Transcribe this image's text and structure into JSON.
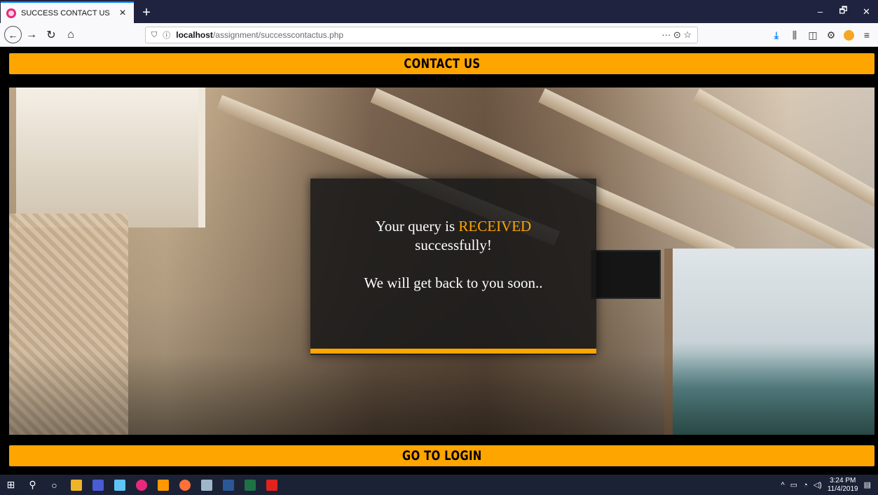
{
  "browser": {
    "tab_title": "SUCCESS CONTACT US",
    "tab_close": "×",
    "new_tab": "+",
    "url_host": "localhost",
    "url_path": "/assignment/successcontactus.php",
    "url_actions": "··· ⊙ ☆",
    "window_controls": [
      "–",
      "🗗",
      "✕"
    ]
  },
  "page": {
    "header": "CONTACT US",
    "message": {
      "line1_prefix": "Your query is ",
      "line1_accent": "RECEIVED",
      "line1_suffix": "successfully!",
      "line2": "We will get back to you soon.."
    },
    "footer_button": "GO TO LOGIN"
  },
  "taskbar": {
    "time": "3:24 PM",
    "date": "11/4/2019"
  },
  "colors": {
    "accent": "#ffa500",
    "tab_strip": "#202340",
    "taskbar": "#1b2236"
  }
}
